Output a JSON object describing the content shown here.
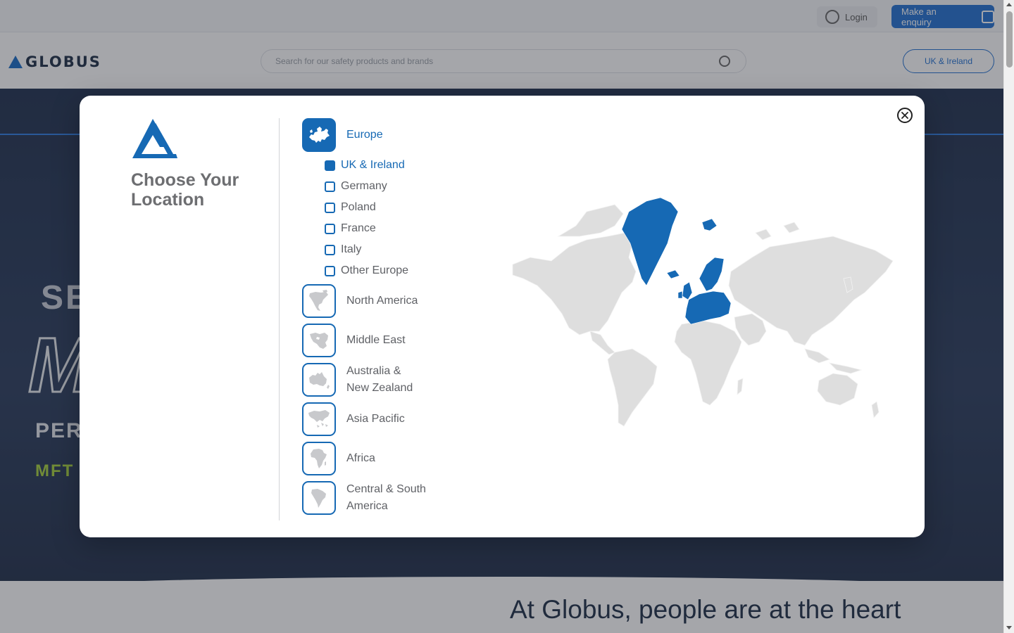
{
  "background": {
    "login_label": "Login",
    "enquiry_label": "Make an enquiry",
    "search_placeholder": "Search for our safety products and brands",
    "region_selector_label": "UK & Ireland",
    "logo_text": "GLOBUS",
    "hero": {
      "line1": "SE",
      "line2": "M",
      "line3": "PER",
      "line4": "MFT"
    },
    "tagline": "At Globus, people are at the heart"
  },
  "modal": {
    "title": "Choose Your Location",
    "selected_region": "Europe",
    "selected_country": "UK & Ireland",
    "regions": [
      {
        "label": "Europe",
        "icon": "europe-map-icon",
        "active": true
      },
      {
        "label": "North America",
        "icon": "north-america-map-icon",
        "active": false
      },
      {
        "label": "Middle East",
        "icon": "middle-east-map-icon",
        "active": false
      },
      {
        "label": "Australia & New Zealand",
        "icon": "australia-map-icon",
        "active": false
      },
      {
        "label": "Asia Pacific",
        "icon": "asia-pacific-map-icon",
        "active": false
      },
      {
        "label": "Africa",
        "icon": "africa-map-icon",
        "active": false
      },
      {
        "label": "Central & South America",
        "icon": "south-america-map-icon",
        "active": false
      }
    ],
    "europe_countries": [
      {
        "label": "UK & Ireland",
        "checked": true
      },
      {
        "label": "Germany",
        "checked": false
      },
      {
        "label": "Poland",
        "checked": false
      },
      {
        "label": "France",
        "checked": false
      },
      {
        "label": "Italy",
        "checked": false
      },
      {
        "label": "Other Europe",
        "checked": false
      }
    ],
    "colors": {
      "accent": "#1669b4",
      "map_land": "#dedede",
      "map_highlight": "#1669b4",
      "title_text": "#6d6e71"
    }
  }
}
